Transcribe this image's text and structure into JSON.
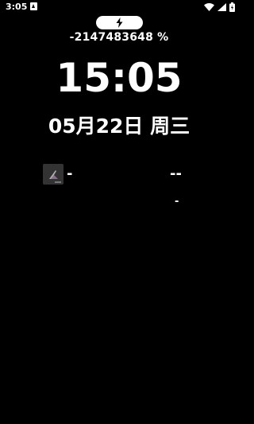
{
  "status_bar": {
    "time": "3:05",
    "icons": [
      "notification-icon",
      "wifi-icon",
      "signal-icon",
      "battery-charging-icon"
    ]
  },
  "lockscreen": {
    "charging_icon": "lightning-bolt-icon",
    "battery_text": "-2147483648 %",
    "clock": "15:05",
    "date": "05月22日 周三"
  },
  "media": {
    "title": "-",
    "time": "--",
    "subtitle": "-"
  },
  "colors": {
    "background": "#000000",
    "foreground": "#ffffff"
  }
}
